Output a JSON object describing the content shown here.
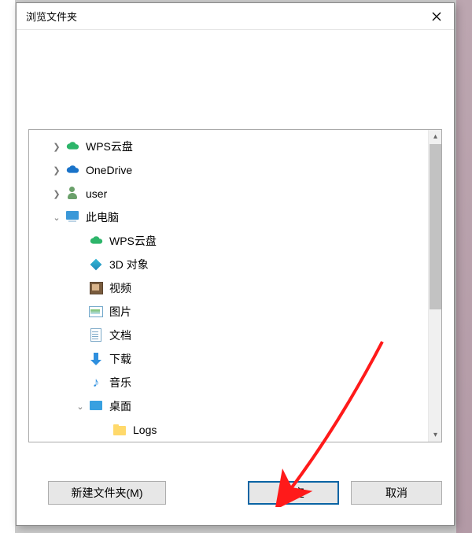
{
  "dialog": {
    "title": "浏览文件夹"
  },
  "tree": [
    {
      "indent": 0,
      "toggle": "closed",
      "icon": "cloud-green",
      "label": "WPS云盘"
    },
    {
      "indent": 0,
      "toggle": "closed",
      "icon": "onedrive",
      "label": "OneDrive"
    },
    {
      "indent": 0,
      "toggle": "closed",
      "icon": "user",
      "label": "user"
    },
    {
      "indent": 0,
      "toggle": "open",
      "icon": "pc",
      "label": "此电脑"
    },
    {
      "indent": 1,
      "toggle": "none",
      "icon": "cloud-green",
      "label": "WPS云盘"
    },
    {
      "indent": 1,
      "toggle": "none",
      "icon": "3d",
      "label": "3D 对象"
    },
    {
      "indent": 1,
      "toggle": "none",
      "icon": "video",
      "label": "视频"
    },
    {
      "indent": 1,
      "toggle": "none",
      "icon": "img",
      "label": "图片"
    },
    {
      "indent": 1,
      "toggle": "none",
      "icon": "doc",
      "label": "文档"
    },
    {
      "indent": 1,
      "toggle": "none",
      "icon": "down",
      "label": "下载"
    },
    {
      "indent": 1,
      "toggle": "none",
      "icon": "music",
      "label": "音乐"
    },
    {
      "indent": 1,
      "toggle": "open",
      "icon": "desktop",
      "label": "桌面"
    },
    {
      "indent": 2,
      "toggle": "none",
      "icon": "folder",
      "label": "Logs"
    }
  ],
  "buttons": {
    "new_folder": "新建文件夹(M)",
    "ok": "确定",
    "cancel": "取消"
  }
}
